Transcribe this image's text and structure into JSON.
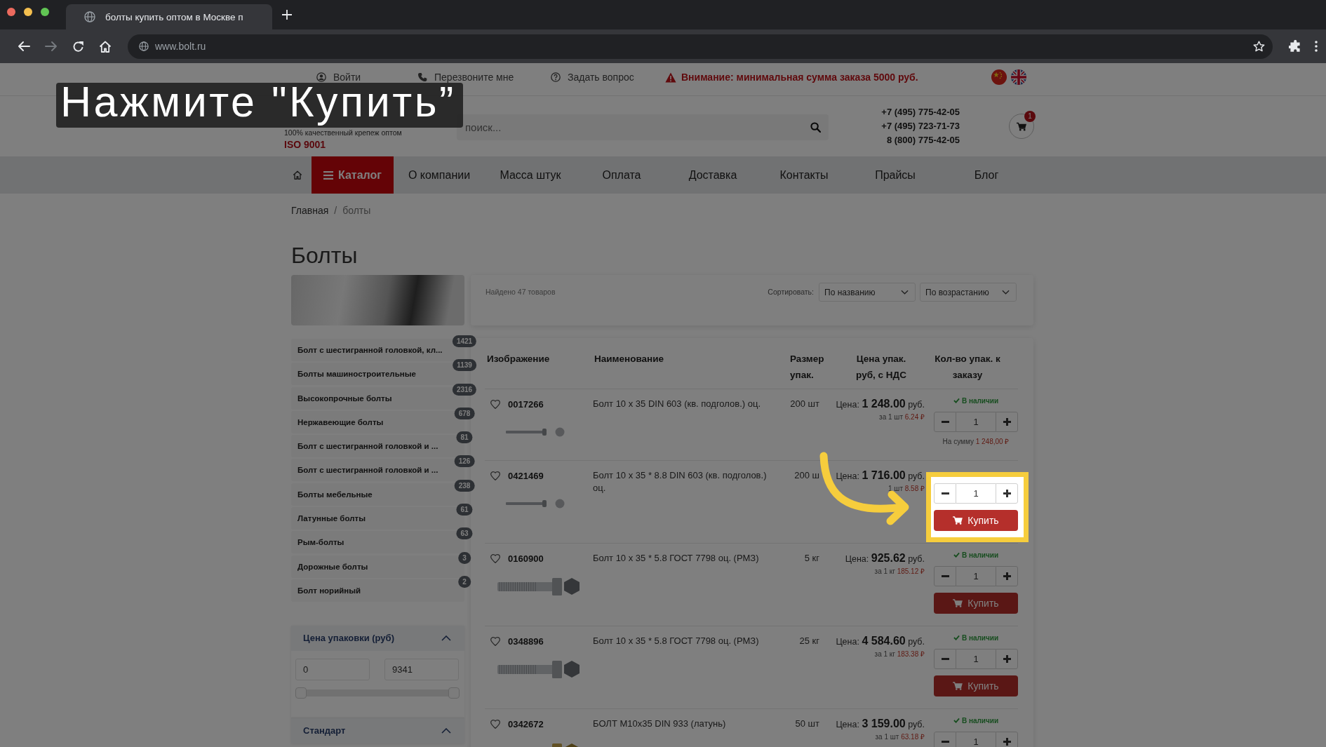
{
  "browser": {
    "tab_title": "болты купить оптом в Москве п",
    "url": "www.bolt.ru",
    "forward_enabled": false
  },
  "topbar": {
    "links": [
      {
        "kind": "user",
        "label": "Войти"
      },
      {
        "kind": "phone",
        "label": "Перезвоните мне"
      },
      {
        "kind": "question",
        "label": "Задать вопрос"
      }
    ],
    "notice": "Внимание: минимальная сумма заказа 5000 руб."
  },
  "header": {
    "tagline": "100% качественный крепеж оптом",
    "certificate": "ISO 9001",
    "search": {
      "placeholder": "поиск..."
    },
    "phones": [
      "+7 (495) 775-42-05",
      "+7 (495) 723-71-73",
      "8 (800) 775-42-05"
    ],
    "cart_count": "1"
  },
  "nav": {
    "catalog": "Каталог",
    "items": [
      "О компании",
      "Масса штук",
      "Оплата",
      "Доставка",
      "Контакты",
      "Прайсы",
      "Блог"
    ]
  },
  "breadcrumb": {
    "items": [
      "Главная",
      "болты"
    ],
    "separator": "/"
  },
  "title": "Болты",
  "sidebar": {
    "categories": [
      {
        "label": "Болт с шестигранной головкой, кл...",
        "count": "1421"
      },
      {
        "label": "Болты машиностроительные",
        "count": "1139"
      },
      {
        "label": "Высокопрочные болты",
        "count": "2316"
      },
      {
        "label": "Нержавеющие болты",
        "count": "678"
      },
      {
        "label": "Болт с шестигранной головкой и ...",
        "count": "81"
      },
      {
        "label": "Болт с шестигранной головкой и ...",
        "count": "126"
      },
      {
        "label": "Болты мебельные",
        "count": "238"
      },
      {
        "label": "Латунные болты",
        "count": "61"
      },
      {
        "label": "Рым-болты",
        "count": "63"
      },
      {
        "label": "Дорожные болты",
        "count": "3"
      },
      {
        "label": "Болт норийный",
        "count": "2"
      }
    ],
    "filters": [
      {
        "title": "Цена упаковки (руб)",
        "expanded": true,
        "min": "0",
        "max": "9341",
        "thumbs": [
          {
            "level": 0
          },
          {
            "level": 1
          }
        ]
      },
      {
        "title": "Стандарт",
        "expanded": true
      }
    ]
  },
  "listing": {
    "found": "Найдено 47 товаров",
    "sort_label": "Сортировать:",
    "sorts": [
      "По названию",
      "По возрастанию"
    ]
  },
  "table": {
    "columns": [
      "Изображение",
      "Наименование",
      "Размер упак.",
      "Цена упак. руб, с НДС",
      "Кол-во упак. к заказу"
    ],
    "rows": [
      {
        "code": "0017266",
        "favorite": false,
        "photo": {
          "kind": "carriage"
        },
        "name": "Болт 10 x 35 DIN 603 (кв. подголов.) оц.",
        "size": "200 шт",
        "price_label": "Цена:",
        "price": "1 248.00",
        "currency": "руб.",
        "unit_label": "за 1 шт",
        "unit_price": "6.24 ₽",
        "stock": "В наличии",
        "quantity": "1",
        "total_label": "На сумму",
        "total": "1 248,00 ₽",
        "highlighted": false
      },
      {
        "code": "0421469",
        "favorite": false,
        "photo": {
          "kind": "carriage"
        },
        "name": "Болт 10 x 35 * 8.8 DIN 603 (кв. подголов.) оц.",
        "size": "200 ш",
        "price_label": "Цена:",
        "price": "1 716.00",
        "currency": "руб.",
        "unit_label": "1 шт",
        "unit_price": "8.58 ₽",
        "quantity": "1",
        "buy": "Купить",
        "highlighted": true
      },
      {
        "code": "0160900",
        "favorite": false,
        "photo": {
          "kind": "hex"
        },
        "name": "Болт 10 x 35 * 5.8 ГОСТ 7798 оц. (РМЗ)",
        "size": "5 кг",
        "price_label": "Цена:",
        "price": "925.62",
        "currency": "руб.",
        "unit_label": "за 1 кг",
        "unit_price": "185.12 ₽",
        "stock": "В наличии",
        "quantity": "1",
        "buy": "Купить",
        "highlighted": false
      },
      {
        "code": "0348896",
        "favorite": false,
        "photo": {
          "kind": "hex"
        },
        "name": "Болт 10 x 35 * 5.8 ГОСТ 7798 оц. (РМЗ)",
        "size": "25 кг",
        "price_label": "Цена:",
        "price": "4 584.60",
        "currency": "руб.",
        "unit_label": "за 1 кг",
        "unit_price": "183.38 ₽",
        "stock": "В наличии",
        "quantity": "1",
        "buy": "Купить",
        "highlighted": false
      },
      {
        "code": "0342672",
        "favorite": false,
        "photo": {
          "kind": "brass"
        },
        "name": "БОЛТ М10x35 DIN 933 (латунь)",
        "size": "50 шт",
        "price_label": "Цена:",
        "price": "3 159.00",
        "currency": "руб.",
        "unit_label": "за 1 шт",
        "unit_price": "63.18 ₽",
        "stock": "В наличии",
        "quantity": "1",
        "highlighted": false
      }
    ]
  },
  "tutorial": {
    "caption": "Нажмите \"Купить”"
  }
}
